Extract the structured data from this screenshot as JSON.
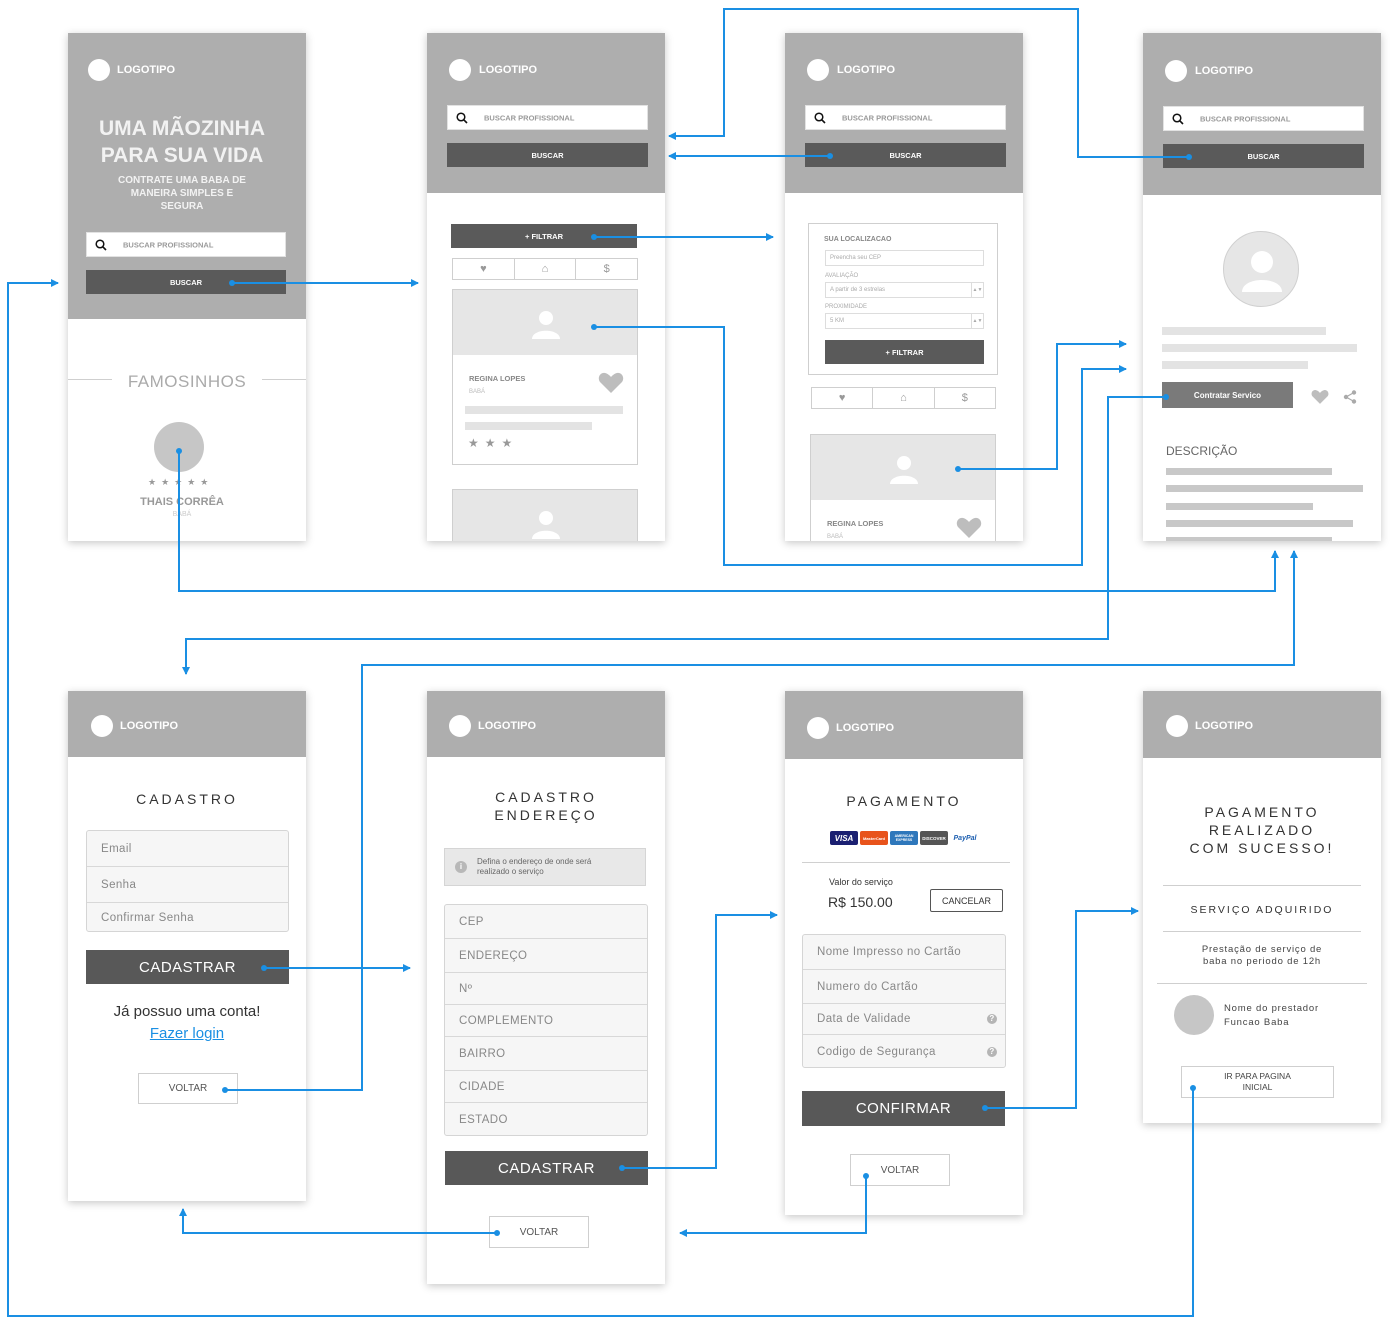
{
  "logo": "LOGOTIPO",
  "search_placeholder": "BUSCAR PROFISSIONAL",
  "search_button": "BUSCAR",
  "home": {
    "hero_line1": "UMA MÃOZINHA",
    "hero_line2": "PARA SUA VIDA",
    "hero_sub1": "CONTRATE UMA BABA DE",
    "hero_sub2": "MANEIRA SIMPLES E",
    "hero_sub3": "SEGURA",
    "famous_title": "FAMOSINHOS",
    "famous_name": "THAIS CORRÊA",
    "famous_role": "BABÁ",
    "stars": "★★★★★"
  },
  "results": {
    "filter_button": "+ FILTRAR",
    "card_name": "REGINA LOPES",
    "card_role": "BABÁ",
    "stars": "★★★"
  },
  "filter": {
    "location_label": "SUA LOCALIZACAO",
    "cep_placeholder": "Preencha seu  CEP",
    "rating_label": "AVALIAÇÃO",
    "rating_value": "A partir de 3 estrelas",
    "proximity_label": "PROXIMIDADE",
    "proximity_value": "5 KM",
    "filter_button": "+ FILTRAR",
    "card_name": "REGINA LOPES",
    "card_role": "BABÁ"
  },
  "profile": {
    "hire_button": "Contratar Servico",
    "description_title": "DESCRIÇÃO"
  },
  "signup": {
    "title": "CADASTRO",
    "fields": [
      "Email",
      "Senha",
      "Confirmar Senha"
    ],
    "submit": "CADASTRAR",
    "have_account": "Já possuo uma conta!",
    "login_link": "Fazer login",
    "back": "VOLTAR"
  },
  "address": {
    "title_line1": "CADASTRO",
    "title_line2": "ENDEREÇO",
    "info_line1": "Defina o endereço de onde será",
    "info_line2": "realizado o serviço",
    "fields": [
      "CEP",
      "ENDEREÇO",
      "Nº",
      "COMPLEMENTO",
      "BAIRRO",
      "CIDADE",
      "ESTADO"
    ],
    "submit": "CADASTRAR",
    "back": "VOLTAR"
  },
  "payment": {
    "title": "PAGAMENTO",
    "card_brands": [
      "VISA",
      "MasterCard",
      "AMERICAN EXPRESS",
      "DISCOVER",
      "PayPal"
    ],
    "service_value_label": "Valor do serviço",
    "service_value": "R$ 150.00",
    "cancel": "CANCELAR",
    "fields": [
      "Nome Impresso no Cartão",
      "Numero do Cartão",
      "Data de Validade",
      "Codigo de Segurança"
    ],
    "confirm": "CONFIRMAR",
    "back": "VOLTAR"
  },
  "success": {
    "title_line1": "PAGAMENTO",
    "title_line2": "REALIZADO",
    "title_line3": "COM SUCESSO!",
    "acquired": "SERVIÇO ADQUIRIDO",
    "service_line1": "Prestação de serviço de",
    "service_line2": "baba no periodo de 12h",
    "provider_name": "Nome do prestador",
    "provider_role": "Funcao Baba",
    "home_button_line1": "IR PARA PAGINA",
    "home_button_line2": "INICIAL"
  },
  "colors": {
    "header_gray": "#aeaeae",
    "dark_button": "#5a5a5a",
    "arrow_blue": "#1a8fe3"
  }
}
